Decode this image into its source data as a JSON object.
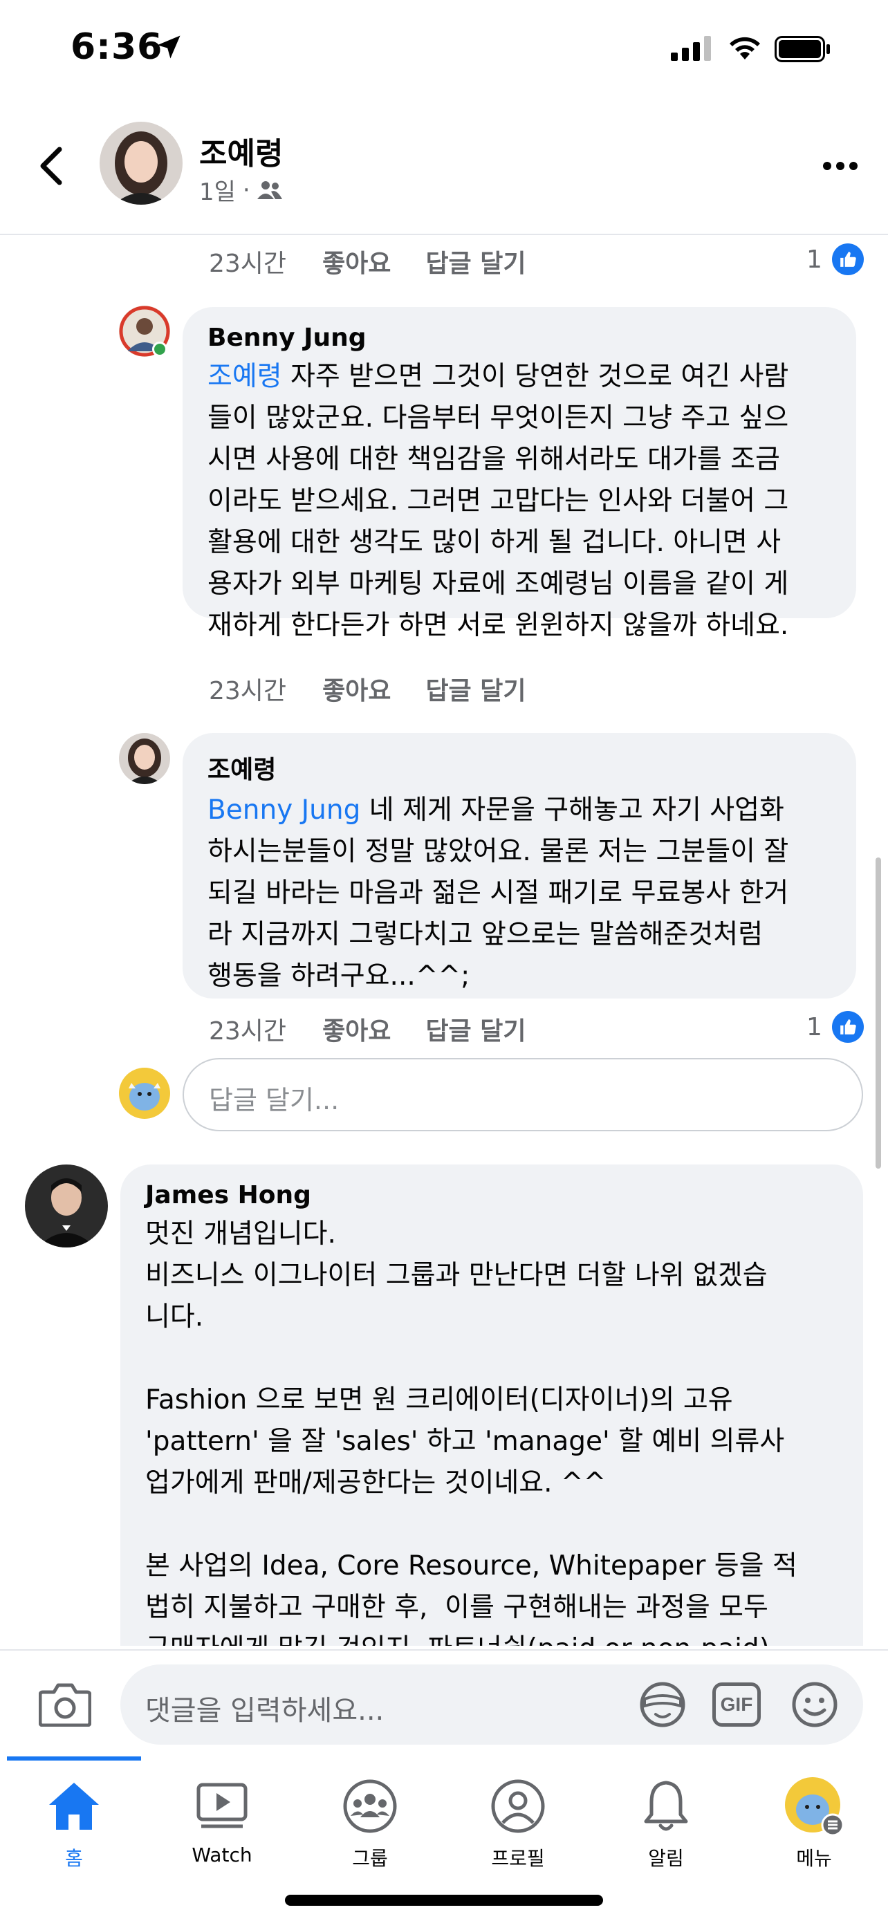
{
  "status": {
    "time": "6:36"
  },
  "header": {
    "author_name": "조예령",
    "post_age": "1일",
    "audience_icon": "friends-icon"
  },
  "comments": [
    {
      "meta": {
        "time": "23시간",
        "like": "좋아요",
        "reply": "답글 달기",
        "reaction_count": "1"
      }
    },
    {
      "author": "Benny Jung",
      "mention": "조예령",
      "text": " 자주 받으면 그것이 당연한 것으로 여긴 사람\n들이 많았군요. 다음부터 무엇이든지 그냥 주고 싶으\n시면 사용에 대한 책임감을 위해서라도 대가를 조금\n이라도 받으세요. 그러면 고맙다는 인사와 더불어 그\n활용에 대한 생각도 많이 하게 될 겁니다. 아니면 사\n용자가 외부 마케팅 자료에 조예령님 이름을 같이 게\n재하게 한다든가 하면 서로 윈윈하지 않을까 하네요.",
      "meta": {
        "time": "23시간",
        "like": "좋아요",
        "reply": "답글 달기"
      }
    },
    {
      "author": "조예령",
      "mention": "Benny Jung",
      "text": " 네 제게 자문을 구해놓고 자기 사업화\n하시는분들이 정말 많았어요. 물론 저는 그분들이 잘\n되길 바라는 마음과 젊은 시절 패기로 무료봉사 한거\n라 지금까지 그렇다치고 앞으로는 말씀해준것처럼\n행동을 하려구요...^^;",
      "meta": {
        "time": "23시간",
        "like": "좋아요",
        "reply": "답글 달기",
        "reaction_count": "1"
      }
    },
    {
      "author": "James Hong",
      "text": "멋진 개념입니다.\n비즈니스 이그나이터 그룹과 만난다면 더할 나위 없겠습\n니다.\n\nFashion 으로 보면 원 크리에이터(디자이너)의 고유\n'pattern' 을 잘 'sales' 하고 'manage' 할 예비 의류사\n업가에게 판매/제공한다는 것이네요. ^^\n\n본 사업의 Idea, Core Resource, Whitepaper 등을 적\n법히 지불하고 구매한 후,  이를 구현해내는 과정을 모두\n구매자에게 맡긴 것인지, 파트너쉽(paid or non-paid)"
    }
  ],
  "reply_box": {
    "placeholder": "답글 달기..."
  },
  "composer": {
    "placeholder": "댓글을 입력하세요...",
    "gif_label": "GIF"
  },
  "tabs": [
    {
      "label": "홈",
      "icon": "home-icon",
      "active": true
    },
    {
      "label": "Watch",
      "icon": "watch-icon"
    },
    {
      "label": "그룹",
      "icon": "groups-icon"
    },
    {
      "label": "프로필",
      "icon": "profile-icon"
    },
    {
      "label": "알림",
      "icon": "bell-icon"
    },
    {
      "label": "메뉴",
      "icon": "menu-avatar-icon"
    }
  ],
  "colors": {
    "accent": "#1877f2",
    "bubble": "#f0f2f5",
    "secondary_text": "#65676b"
  }
}
